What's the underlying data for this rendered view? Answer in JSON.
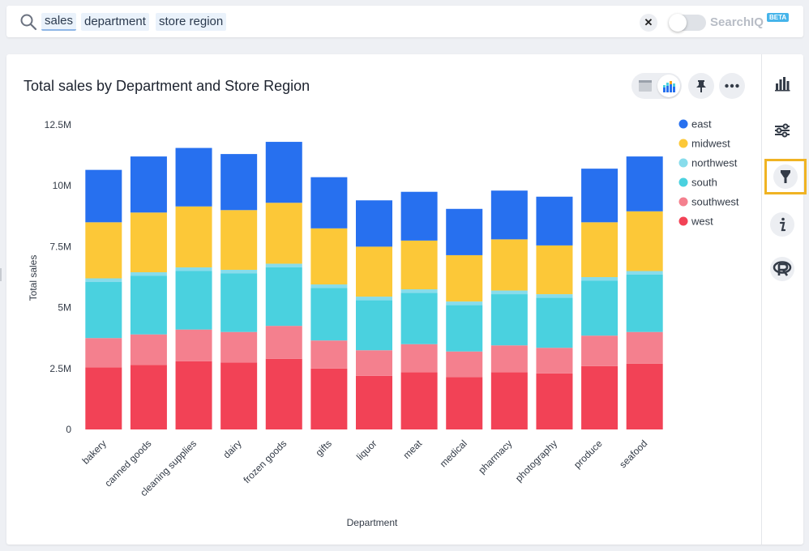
{
  "search": {
    "tokens": [
      "sales",
      "department",
      "store region"
    ],
    "clear_label": "✕",
    "searchiq_label": "SearchIQ",
    "beta_label": "BETA"
  },
  "colors": {
    "accent": "#2770ef",
    "highlight": "#f0b323"
  },
  "card": {
    "title": "Total sales by Department and Store Region"
  },
  "toolbar": {
    "icons": [
      "table-view-icon",
      "chart-view-icon",
      "pin-icon",
      "more-icon"
    ]
  },
  "sidebar": {
    "icons": [
      "chart-type-icon",
      "configure-icon",
      "filter-icon",
      "info-icon",
      "r-analysis-icon"
    ],
    "highlighted": "filter-icon"
  },
  "chart_data": {
    "type": "bar",
    "stacked": true,
    "xlabel": "Department",
    "ylabel": "Total sales",
    "ylim": [
      0,
      12500000
    ],
    "y_ticks": [
      "0",
      "2.5M",
      "5M",
      "7.5M",
      "10M",
      "12.5M"
    ],
    "categories": [
      "bakery",
      "canned goods",
      "cleaning supplies",
      "dairy",
      "frozen goods",
      "gifts",
      "liquor",
      "meat",
      "medical",
      "pharmacy",
      "photography",
      "produce",
      "seafood"
    ],
    "series": [
      {
        "name": "west",
        "color": "#f24256",
        "values": [
          2550000,
          2650000,
          2800000,
          2750000,
          2900000,
          2500000,
          2200000,
          2350000,
          2150000,
          2350000,
          2300000,
          2600000,
          2700000
        ]
      },
      {
        "name": "southwest",
        "color": "#f4808e",
        "values": [
          1200000,
          1250000,
          1300000,
          1250000,
          1350000,
          1150000,
          1050000,
          1150000,
          1050000,
          1100000,
          1050000,
          1250000,
          1300000
        ]
      },
      {
        "name": "south",
        "color": "#4ad1df",
        "values": [
          2300000,
          2400000,
          2400000,
          2400000,
          2400000,
          2150000,
          2050000,
          2100000,
          1900000,
          2100000,
          2050000,
          2250000,
          2350000
        ]
      },
      {
        "name": "northwest",
        "color": "#87dceb",
        "values": [
          150000,
          150000,
          150000,
          150000,
          150000,
          150000,
          150000,
          150000,
          150000,
          150000,
          150000,
          150000,
          150000
        ]
      },
      {
        "name": "midwest",
        "color": "#fcc838",
        "values": [
          2300000,
          2450000,
          2500000,
          2450000,
          2500000,
          2300000,
          2050000,
          2000000,
          1900000,
          2100000,
          2000000,
          2250000,
          2450000
        ]
      },
      {
        "name": "east",
        "color": "#2770ef",
        "values": [
          2150000,
          2300000,
          2400000,
          2300000,
          2500000,
          2100000,
          1900000,
          2000000,
          1900000,
          2000000,
          2000000,
          2200000,
          2250000
        ]
      }
    ],
    "legend": {
      "placement": "top-right",
      "order": [
        "east",
        "midwest",
        "northwest",
        "south",
        "southwest",
        "west"
      ]
    }
  }
}
